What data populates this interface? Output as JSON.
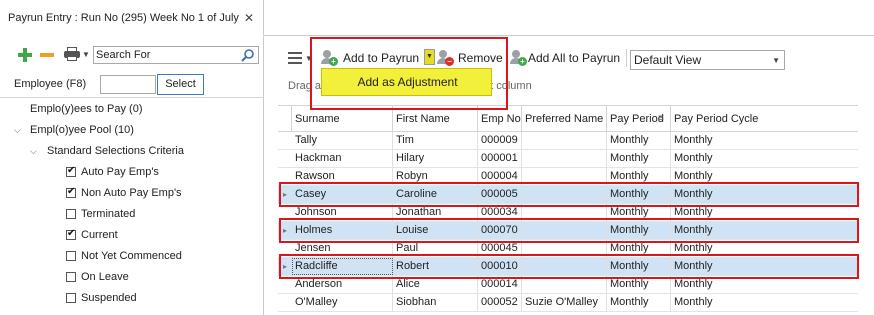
{
  "tab": {
    "title": "Payrun Entry : Run No (295) Week No 1 of July",
    "close": "✕"
  },
  "left": {
    "search": {
      "placeholder": "Search For",
      "value": ""
    },
    "employee": {
      "label": "Employee (F8)",
      "value": "",
      "select_label": "Select"
    },
    "tree": [
      {
        "label": "Emplo(y)ees to Pay (0)",
        "level": 0,
        "type": "node"
      },
      {
        "label": "Empl(o)yee Pool (10)",
        "level": 0,
        "type": "group",
        "expanded": true
      },
      {
        "label": "Standard Selections Criteria",
        "level": 1,
        "type": "group",
        "expanded": true
      },
      {
        "label": "Auto Pay Emp's",
        "level": 2,
        "type": "check",
        "checked": true
      },
      {
        "label": "Non Auto Pay Emp's",
        "level": 2,
        "type": "check",
        "checked": true
      },
      {
        "label": "Terminated",
        "level": 2,
        "type": "check",
        "checked": false
      },
      {
        "label": "Current",
        "level": 2,
        "type": "check",
        "checked": true
      },
      {
        "label": "Not Yet Commenced",
        "level": 2,
        "type": "check",
        "checked": false
      },
      {
        "label": "On Leave",
        "level": 2,
        "type": "check",
        "checked": false
      },
      {
        "label": "Suspended",
        "level": 2,
        "type": "check",
        "checked": false
      }
    ]
  },
  "toolbar": {
    "add_label": "Add to Payrun",
    "remove_label": "Remove",
    "add_all_label": "Add All to Payrun",
    "view_value": "Default View",
    "dropdown_item": "Add as Adjustment"
  },
  "group_hint": {
    "start": "Drag a",
    "end": "at column"
  },
  "grid": {
    "columns": [
      "Surname",
      "First Name",
      "Emp No",
      "Preferred Name",
      "Pay Period",
      "Pay Period Cycle"
    ],
    "rows": [
      {
        "surname": "Tally",
        "first": "Tim",
        "emp_no": "000009",
        "preferred": "",
        "pay_period": "Monthly",
        "cycle": "Monthly",
        "selected": false
      },
      {
        "surname": "Hackman",
        "first": "Hilary",
        "emp_no": "000001",
        "preferred": "",
        "pay_period": "Monthly",
        "cycle": "Monthly",
        "selected": false
      },
      {
        "surname": "Rawson",
        "first": "Robyn",
        "emp_no": "000004",
        "preferred": "",
        "pay_period": "Monthly",
        "cycle": "Monthly",
        "selected": false
      },
      {
        "surname": "Casey",
        "first": "Caroline",
        "emp_no": "000005",
        "preferred": "",
        "pay_period": "Monthly",
        "cycle": "Monthly",
        "selected": true
      },
      {
        "surname": "Johnson",
        "first": "Jonathan",
        "emp_no": "000034",
        "preferred": "",
        "pay_period": "Monthly",
        "cycle": "Monthly",
        "selected": false
      },
      {
        "surname": "Holmes",
        "first": "Louise",
        "emp_no": "000070",
        "preferred": "",
        "pay_period": "Monthly",
        "cycle": "Monthly",
        "selected": true
      },
      {
        "surname": "Jensen",
        "first": "Paul",
        "emp_no": "000045",
        "preferred": "",
        "pay_period": "Monthly",
        "cycle": "Monthly",
        "selected": false
      },
      {
        "surname": "Radcliffe",
        "first": "Robert",
        "emp_no": "000010",
        "preferred": "",
        "pay_period": "Monthly",
        "cycle": "Monthly",
        "selected": true,
        "focused": true
      },
      {
        "surname": "Anderson",
        "first": "Alice",
        "emp_no": "000014",
        "preferred": "",
        "pay_period": "Monthly",
        "cycle": "Monthly",
        "selected": false
      },
      {
        "surname": "O'Malley",
        "first": "Siobhan",
        "emp_no": "000052",
        "preferred": "Suzie O'Malley",
        "pay_period": "Monthly",
        "cycle": "Monthly",
        "selected": false
      }
    ]
  },
  "colors": {
    "highlight_box": "#d9151d",
    "selected_row": "#cfe3f5",
    "dropdown_bg": "#f2f03a",
    "add_icon": "#3ea84a",
    "remove_icon": "#f0a020"
  },
  "icons": [
    "plus-icon",
    "minus-icon",
    "printer-icon",
    "search-icon",
    "hamburger-icon",
    "user-add-icon",
    "user-remove-icon",
    "user-add-all-icon",
    "sort-icon",
    "close-icon"
  ]
}
